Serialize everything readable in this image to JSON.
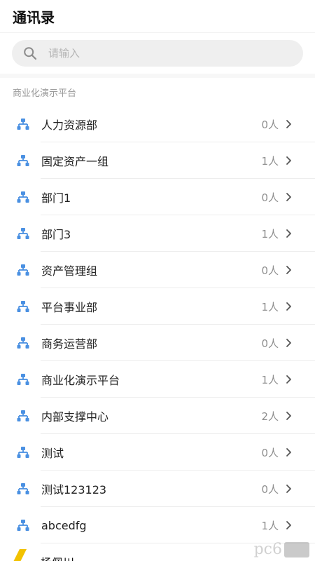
{
  "header": {
    "title": "通讯录"
  },
  "search": {
    "placeholder": "请输入",
    "icon": "search-icon"
  },
  "section": {
    "title": "商业化演示平台"
  },
  "departments": [
    {
      "name": "人力资源部",
      "count": "0人"
    },
    {
      "name": "固定资产一组",
      "count": "1人"
    },
    {
      "name": "部门1",
      "count": "0人"
    },
    {
      "name": "部门3",
      "count": "1人"
    },
    {
      "name": "资产管理组",
      "count": "0人"
    },
    {
      "name": "平台事业部",
      "count": "1人"
    },
    {
      "name": "商务运营部",
      "count": "0人"
    },
    {
      "name": "商业化演示平台",
      "count": "1人"
    },
    {
      "name": "内部支撑中心",
      "count": "2人"
    },
    {
      "name": "测试",
      "count": "0人"
    },
    {
      "name": "测试123123",
      "count": "0人"
    },
    {
      "name": "abcedfg",
      "count": "1人"
    }
  ],
  "partial_member": {
    "name": "杨佩川"
  },
  "colors": {
    "accent": "#4a90e2",
    "text": "#222222",
    "muted": "#8f8f8f",
    "search_bg": "#efefef"
  },
  "watermark": {
    "text": "pc6"
  }
}
